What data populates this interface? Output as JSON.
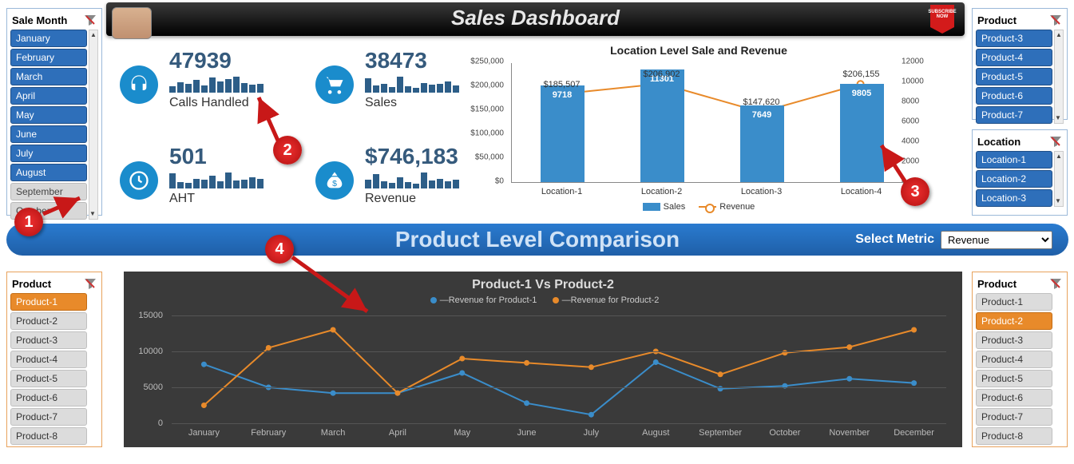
{
  "header": {
    "title": "Sales Dashboard"
  },
  "slicers": {
    "month": {
      "title": "Sale Month",
      "items": [
        "January",
        "February",
        "March",
        "April",
        "May",
        "June",
        "July",
        "August",
        "September",
        "October"
      ]
    },
    "product_top": {
      "title": "Product",
      "items": [
        "Product-3",
        "Product-4",
        "Product-5",
        "Product-6",
        "Product-7"
      ]
    },
    "location": {
      "title": "Location",
      "items": [
        "Location-1",
        "Location-2",
        "Location-3"
      ]
    },
    "product_left": {
      "title": "Product",
      "selected": "Product-1",
      "items": [
        "Product-1",
        "Product-2",
        "Product-3",
        "Product-4",
        "Product-5",
        "Product-6",
        "Product-7",
        "Product-8"
      ]
    },
    "product_right": {
      "title": "Product",
      "selected": "Product-2",
      "items": [
        "Product-1",
        "Product-2",
        "Product-3",
        "Product-4",
        "Product-5",
        "Product-6",
        "Product-7",
        "Product-8"
      ]
    }
  },
  "kpi": {
    "calls": {
      "value": "47939",
      "label": "Calls Handled"
    },
    "sales": {
      "value": "38473",
      "label": "Sales"
    },
    "aht": {
      "value": "501",
      "label": "AHT"
    },
    "revenue": {
      "value": "$746,183",
      "label": "Revenue"
    }
  },
  "section": {
    "title": "Product Level Comparison",
    "metric_label": "Select Metric",
    "metric_value": "Revenue"
  },
  "callouts": {
    "c1": "1",
    "c2": "2",
    "c3": "3",
    "c4": "4"
  },
  "chart_data": [
    {
      "id": "location_sale_revenue",
      "type": "bar+line",
      "title": "Location Level Sale and Revenue",
      "categories": [
        "Location-1",
        "Location-2",
        "Location-3",
        "Location-4"
      ],
      "series": [
        {
          "name": "Sales",
          "type": "bar",
          "axis": "y2",
          "values": [
            9718,
            11301,
            7649,
            9805
          ]
        },
        {
          "name": "Revenue",
          "type": "line",
          "axis": "y1",
          "values": [
            185507,
            206902,
            147620,
            206155
          ],
          "labels": [
            "$185,507",
            "$206,902",
            "$147,620",
            "$206,155"
          ]
        }
      ],
      "y1": {
        "min": 0,
        "max": 250000,
        "ticks": [
          "$0",
          "$50,000",
          "$100,000",
          "$150,000",
          "$200,000",
          "$250,000"
        ]
      },
      "y2": {
        "min": 0,
        "max": 12000,
        "ticks": [
          "0",
          "2000",
          "4000",
          "6000",
          "8000",
          "10000",
          "12000"
        ]
      },
      "legend": [
        "Sales",
        "Revenue"
      ]
    },
    {
      "id": "product_comparison",
      "type": "line",
      "title": "Product-1  Vs  Product-2",
      "x": [
        "January",
        "February",
        "March",
        "April",
        "May",
        "June",
        "July",
        "August",
        "September",
        "October",
        "November",
        "December"
      ],
      "series": [
        {
          "name": "Revenue for Product-1",
          "color": "#3a8dca",
          "values": [
            8200,
            5000,
            4200,
            4200,
            7000,
            2800,
            1200,
            8500,
            4800,
            5200,
            6200,
            5600
          ]
        },
        {
          "name": "Revenue for Product-2",
          "color": "#e88a2a",
          "values": [
            2500,
            10500,
            13000,
            4200,
            9000,
            8400,
            7800,
            10000,
            6800,
            9800,
            10600,
            13000
          ]
        }
      ],
      "ylim": [
        0,
        15000
      ],
      "yticks": [
        "0",
        "5000",
        "10000",
        "15000"
      ]
    }
  ]
}
